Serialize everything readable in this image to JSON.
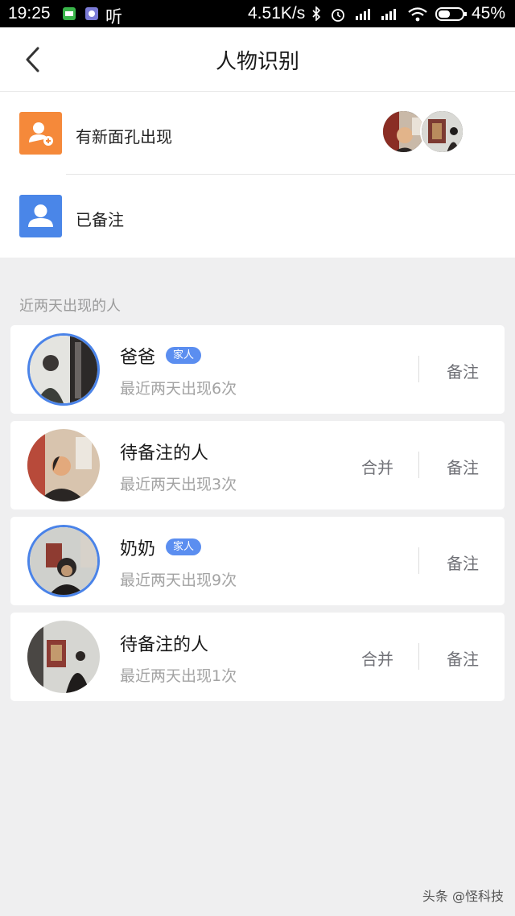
{
  "status_bar": {
    "time": "19:25",
    "app_label": "听",
    "network_speed": "4.51K/s",
    "battery": "45%"
  },
  "header": {
    "title": "人物识别"
  },
  "menu": {
    "new_faces": {
      "label": "有新面孔出现",
      "icon": "add-person-icon",
      "icon_color": "#f5893a"
    },
    "noted": {
      "label": "已备注",
      "icon": "person-icon",
      "icon_color": "#4a86e8"
    }
  },
  "section": {
    "label": "近两天出现的人"
  },
  "people": [
    {
      "name": "爸爸",
      "tag": "家人",
      "subtitle": "最近两天出现6次",
      "note_label": "备注"
    },
    {
      "name": "待备注的人",
      "subtitle": "最近两天出现3次",
      "merge_label": "合并",
      "note_label": "备注"
    },
    {
      "name": "奶奶",
      "tag": "家人",
      "subtitle": "最近两天出现9次",
      "note_label": "备注"
    },
    {
      "name": "待备注的人",
      "subtitle": "最近两天出现1次",
      "merge_label": "合并",
      "note_label": "备注"
    }
  ],
  "watermark": "头条 @怪科技",
  "colors": {
    "accent": "#4a83e8",
    "tag_bg": "#5b8ef0",
    "background": "#efeff0"
  }
}
